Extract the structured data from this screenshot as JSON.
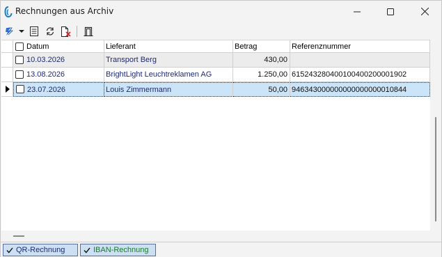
{
  "window": {
    "title": "Rechnungen aus Archiv"
  },
  "toolbar": {
    "icons": [
      "lightning-icon",
      "dropdown-arrow-icon",
      "list-icon",
      "refresh-icon",
      "delete-document-icon",
      "exit-door-icon"
    ]
  },
  "grid": {
    "columns": [
      "Datum",
      "Lieferant",
      "Betrag",
      "Referenznummer"
    ],
    "rows": [
      {
        "datum": "10.03.2026",
        "lieferant": "Transport Berg",
        "betrag": "430,00",
        "referenz": ""
      },
      {
        "datum": "13.08.2026",
        "lieferant": "BrightLight Leuchtreklamen AG",
        "betrag": "1.250,00",
        "referenz": "615243280400100400200001902"
      },
      {
        "datum": "23.07.2026",
        "lieferant": "Louis Zimmermann",
        "betrag": "50,00",
        "referenz": "946343000000000000000010844"
      }
    ]
  },
  "tabs": [
    {
      "label": "QR-Rechnung",
      "checked": true
    },
    {
      "label": "IBAN-Rechnung",
      "checked": true
    }
  ],
  "colors": {
    "selected_row": "#cce4f7",
    "grey_row": "#ececec",
    "tab_bg": "#cde0f3",
    "accent_blue": "#1f2a6e",
    "iban_green": "#1b7a2a"
  }
}
